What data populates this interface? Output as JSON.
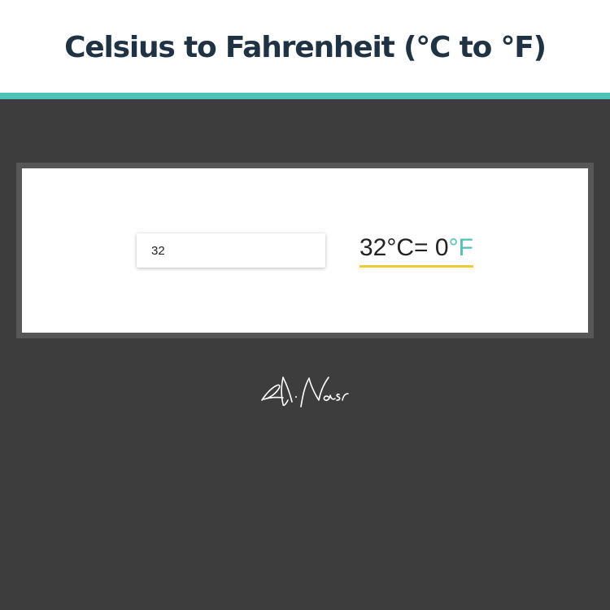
{
  "header": {
    "title": "Celsius to Fahrenheit (°C to °F)"
  },
  "converter": {
    "input_value": "32",
    "result_celsius": "32",
    "result_celsius_unit": "°C",
    "result_equals": "= ",
    "result_fahrenheit": "0",
    "result_fahrenheit_unit": "°F"
  },
  "signature": {
    "text": "A. Nasr"
  },
  "colors": {
    "accent": "#4fc1b9",
    "underline": "#f2c832",
    "title": "#1f3344",
    "background": "#3d3d3d",
    "panel_border": "#575757"
  }
}
